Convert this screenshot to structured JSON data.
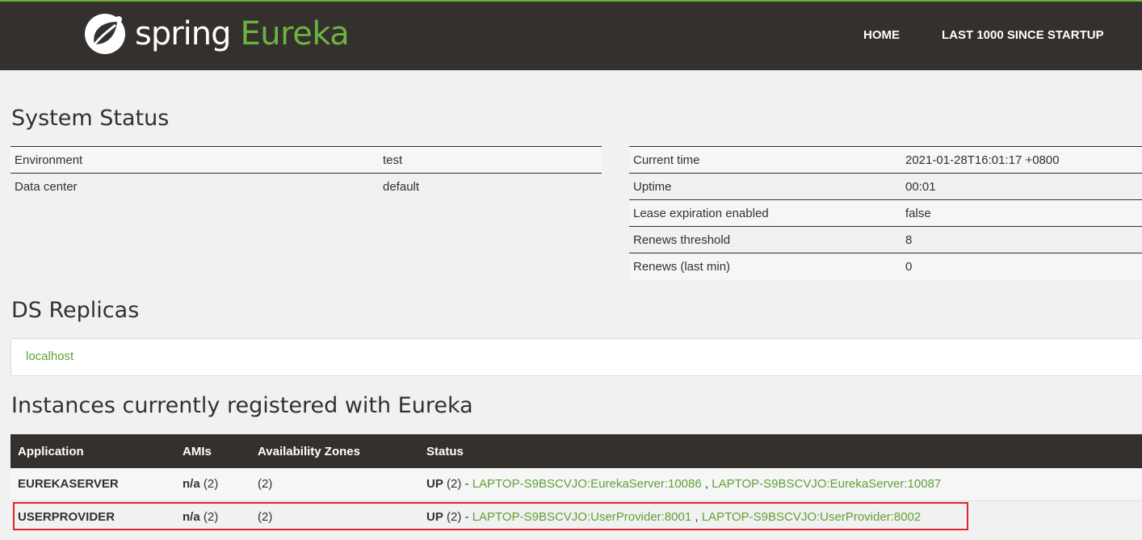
{
  "navbar": {
    "brand_spring": "spring",
    "brand_eureka": "Eureka",
    "home_label": "HOME",
    "last1000_label": "LAST 1000 SINCE STARTUP"
  },
  "system_status": {
    "title": "System Status",
    "left": [
      {
        "key": "Environment",
        "value": "test"
      },
      {
        "key": "Data center",
        "value": "default"
      }
    ],
    "right": [
      {
        "key": "Current time",
        "value": "2021-01-28T16:01:17 +0800"
      },
      {
        "key": "Uptime",
        "value": "00:01"
      },
      {
        "key": "Lease expiration enabled",
        "value": "false"
      },
      {
        "key": "Renews threshold",
        "value": "8"
      },
      {
        "key": "Renews (last min)",
        "value": "0"
      }
    ]
  },
  "ds_replicas": {
    "title": "DS Replicas",
    "items": [
      "localhost"
    ]
  },
  "instances": {
    "title": "Instances currently registered with Eureka",
    "headers": [
      "Application",
      "AMIs",
      "Availability Zones",
      "Status"
    ],
    "rows": [
      {
        "application": "EUREKASERVER",
        "amis_bold": "n/a",
        "amis_count": " (2)",
        "zones": "(2)",
        "status_bold": "UP",
        "status_count": " (2) - ",
        "link1": "LAPTOP-S9BSCVJO:EurekaServer:10086",
        "sep": " , ",
        "link2": "LAPTOP-S9BSCVJO:EurekaServer:10087"
      },
      {
        "application": "USERPROVIDER",
        "amis_bold": "n/a",
        "amis_count": " (2)",
        "zones": "(2)",
        "status_bold": "UP",
        "status_count": " (2) - ",
        "link1": "LAPTOP-S9BSCVJO:UserProvider:8001",
        "sep": " , ",
        "link2": "LAPTOP-S9BSCVJO:UserProvider:8002"
      }
    ]
  },
  "colors": {
    "navbar_bg": "#34302d",
    "spring_green": "#6db33f",
    "link_green": "#5fa134",
    "highlight_red": "#e0242c"
  }
}
